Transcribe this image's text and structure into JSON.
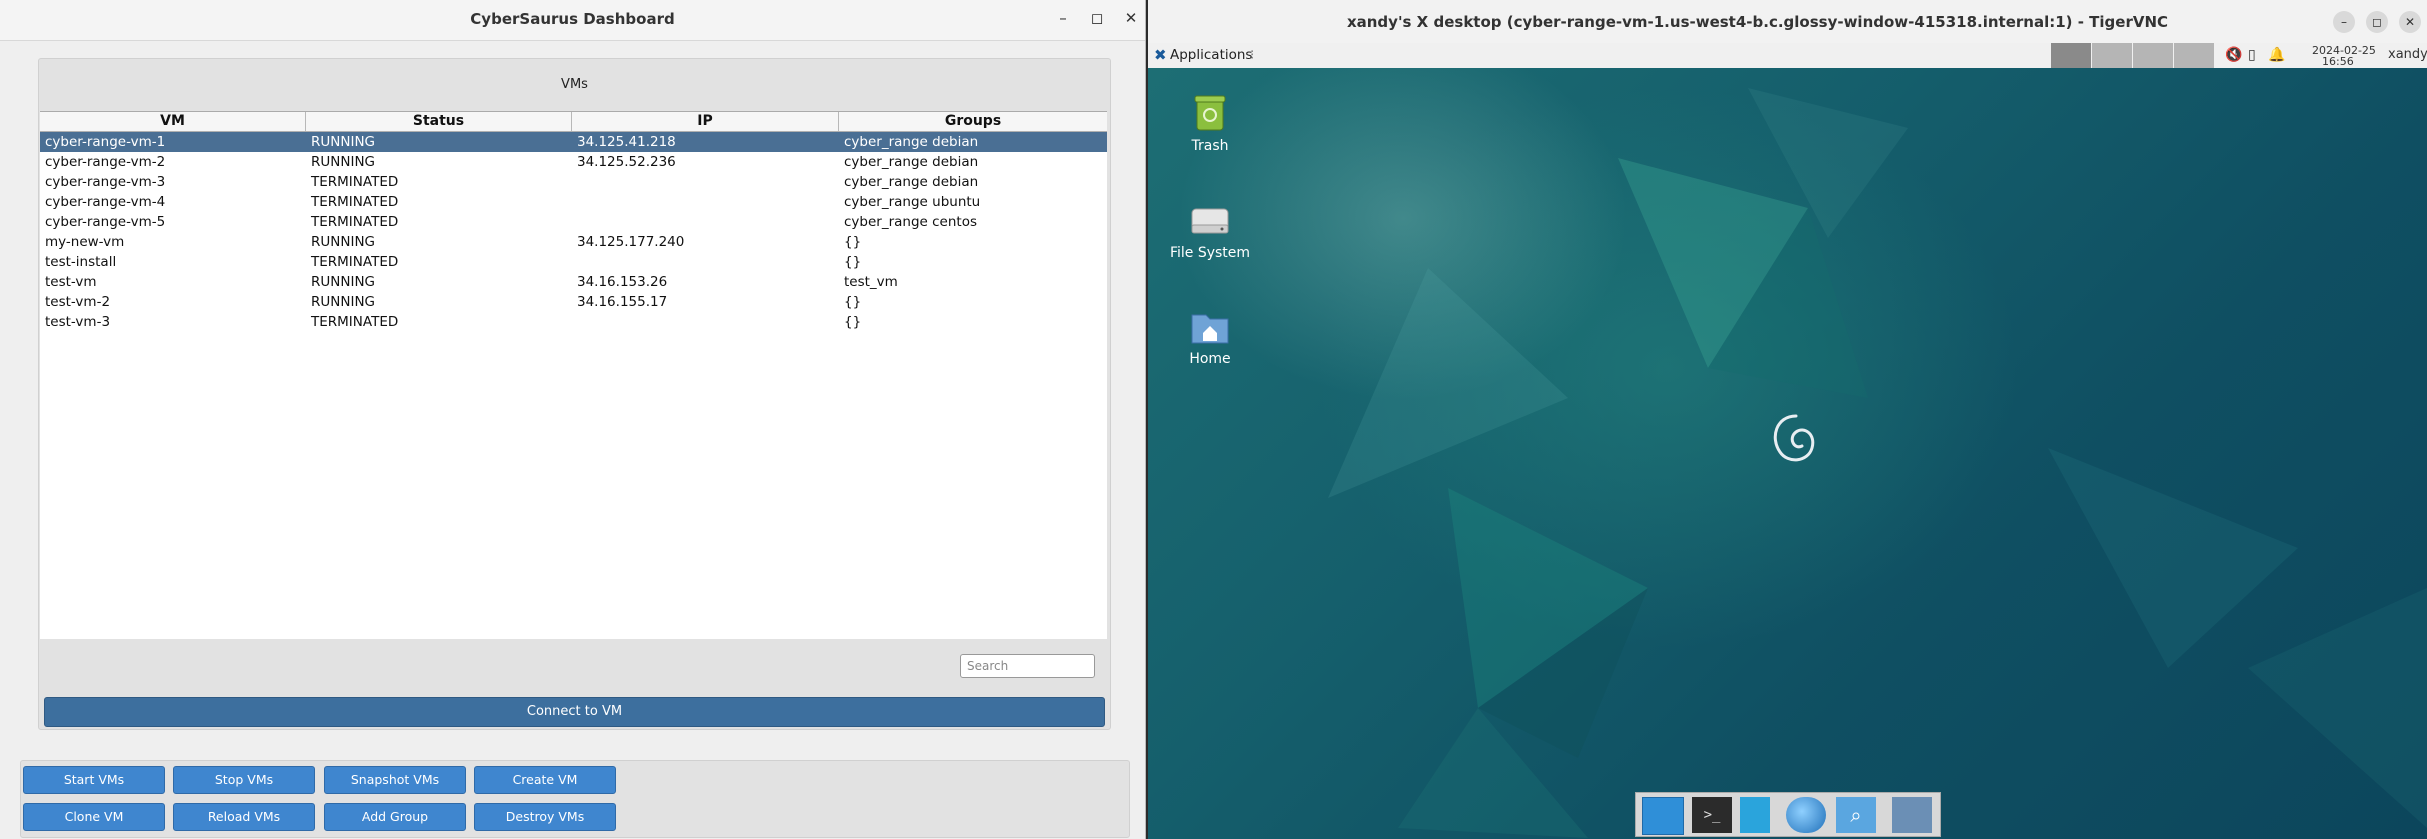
{
  "left_window": {
    "title": "CyberSaurus Dashboard",
    "controls": {
      "minimize": "–",
      "maximize": "◻",
      "close": "✕"
    },
    "vms_panel": {
      "title": "VMs",
      "columns": [
        "VM",
        "Status",
        "IP",
        "Groups"
      ],
      "rows": [
        {
          "vm": "cyber-range-vm-1",
          "status": "RUNNING",
          "ip": "34.125.41.218",
          "groups": "cyber_range debian",
          "selected": true
        },
        {
          "vm": "cyber-range-vm-2",
          "status": "RUNNING",
          "ip": "34.125.52.236",
          "groups": "cyber_range debian"
        },
        {
          "vm": "cyber-range-vm-3",
          "status": "TERMINATED",
          "ip": "",
          "groups": "cyber_range debian"
        },
        {
          "vm": "cyber-range-vm-4",
          "status": "TERMINATED",
          "ip": "",
          "groups": "cyber_range ubuntu"
        },
        {
          "vm": "cyber-range-vm-5",
          "status": "TERMINATED",
          "ip": "",
          "groups": "cyber_range centos"
        },
        {
          "vm": "my-new-vm",
          "status": "RUNNING",
          "ip": "34.125.177.240",
          "groups": "{}"
        },
        {
          "vm": "test-install",
          "status": "TERMINATED",
          "ip": "",
          "groups": "{}"
        },
        {
          "vm": "test-vm",
          "status": "RUNNING",
          "ip": "34.16.153.26",
          "groups": "test_vm"
        },
        {
          "vm": "test-vm-2",
          "status": "RUNNING",
          "ip": "34.16.155.17",
          "groups": "{}"
        },
        {
          "vm": "test-vm-3",
          "status": "TERMINATED",
          "ip": "",
          "groups": "{}"
        }
      ],
      "search_placeholder": "Search",
      "connect_label": "Connect to VM"
    },
    "actions": {
      "start": "Start VMs",
      "stop": "Stop VMs",
      "snapshot": "Snapshot VMs",
      "create": "Create VM",
      "clone": "Clone VM",
      "reload": "Reload VMs",
      "add_group": "Add Group",
      "destroy": "Destroy VMs"
    }
  },
  "right_window": {
    "title": "xandy's X desktop (cyber-range-vm-1.us-west4-b.c.glossy-window-415318.internal:1) - TigerVNC",
    "panel": {
      "applications": "Applications",
      "date": "2024-02-25",
      "time": "16:56",
      "user": "xandy"
    },
    "desktop_icons": [
      "Trash",
      "File System",
      "Home"
    ]
  },
  "colors": {
    "selected_row": "#4a6f94",
    "button_blue": "#3f86cf",
    "connect_blue": "#3d6f9e",
    "desktop_teal": "#155f6c"
  }
}
